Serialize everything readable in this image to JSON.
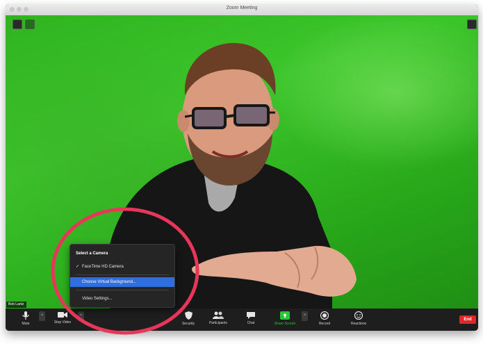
{
  "window": {
    "title": "Zoom Meeting"
  },
  "participant": {
    "name": "Bob Lantz"
  },
  "camera_menu": {
    "header": "Select a Camera",
    "items": [
      {
        "label": "FaceTime HD Camera",
        "checked": true
      },
      {
        "label": "Choose Virtual Background...",
        "selected": true
      },
      {
        "label": "Video Settings..."
      }
    ]
  },
  "toolbar": {
    "mute_label": "Mute",
    "stop_video_label": "Stop Video",
    "security_label": "Security",
    "participants_label": "Participants",
    "chat_label": "Chat",
    "share_screen_label": "Share Screen",
    "record_label": "Record",
    "reactions_label": "Reactions",
    "end_label": "End"
  },
  "colors": {
    "background_green": "#2fb41f",
    "highlight_circle": "#e8365a",
    "menu_selection": "#2f6fdc",
    "share_screen": "#2bc53c",
    "end_button": "#e02828"
  },
  "icons": {
    "mute": "microphone-icon",
    "stop_video": "video-camera-icon",
    "security": "shield-icon",
    "participants": "people-icon",
    "chat": "chat-bubble-icon",
    "share_screen": "share-screen-icon",
    "record": "record-icon",
    "reactions": "smiley-icon",
    "gallery": "grid-icon"
  }
}
